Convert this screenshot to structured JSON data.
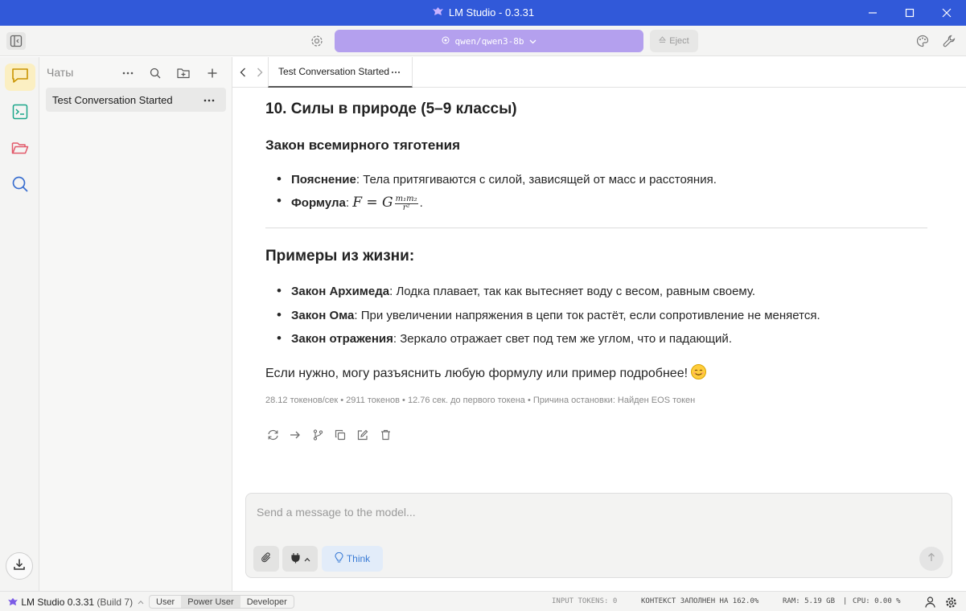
{
  "window": {
    "title": "LM Studio - 0.3.31"
  },
  "topbar": {
    "model_name": "qwen/qwen3-8b",
    "eject_label": "Eject"
  },
  "sidebar": {
    "title": "Чаты",
    "chats": [
      {
        "label": "Test Conversation Started"
      }
    ]
  },
  "tab": {
    "label": "Test Conversation Started"
  },
  "message": {
    "section_heading": "10. Силы в природе (5–9 классы)",
    "subheading": "Закон всемирного тяготения",
    "bullets1": [
      {
        "bold": "Пояснение",
        "text": ": Тела притягиваются с силой, зависящей от масс и расстояния."
      },
      {
        "bold": "Формула",
        "text": ":"
      }
    ],
    "formula": {
      "lhs": "F = G",
      "num": "m₁m₂",
      "den": "r²",
      "end": "."
    },
    "examples_heading": "Примеры из жизни:",
    "bullets2": [
      {
        "bold": "Закон Архимеда",
        "text": ": Лодка плавает, так как вытесняет воду с весом, равным своему."
      },
      {
        "bold": "Закон Ома",
        "text": ": При увеличении напряжения в цепи ток растёт, если сопротивление не меняется."
      },
      {
        "bold": "Закон отражения",
        "text": ": Зеркало отражает свет под тем же углом, что и падающий."
      }
    ],
    "closing": "Если нужно, могу разъяснить любую формулу или пример подробнее!",
    "stats": "28.12 токенов/сек • 2911 токенов • 12.76 сек. до первого токена • Причина остановки: Найден EOS токен"
  },
  "composer": {
    "placeholder": "Send a message to the model...",
    "think_label": "Think"
  },
  "statusbar": {
    "app_name": "LM Studio 0.3.31",
    "build": "(Build 7)",
    "modes": [
      "User",
      "Power User",
      "Developer"
    ],
    "active_mode": "Power User",
    "input_tokens": "INPUT TOKENS: 0",
    "context": "КОНТЕКСТ ЗАПОЛНЕН НА 162.0%",
    "ram": "RAM: 5.19 GB",
    "separator": "|",
    "cpu": "CPU: 0.00 %"
  },
  "colors": {
    "titlebar": "#3159d9",
    "model_pill": "#b4a0ee",
    "active_rail": "#fbefc2",
    "think_text": "#3a7bd5"
  }
}
